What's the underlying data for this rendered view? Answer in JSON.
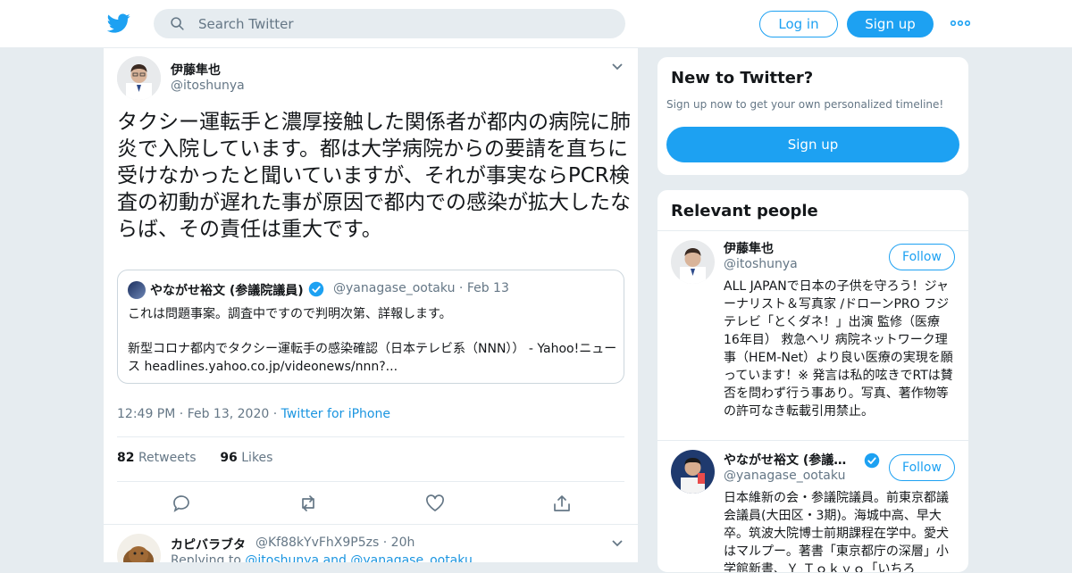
{
  "header": {
    "search_placeholder": "Search Twitter",
    "login_label": "Log in",
    "signup_label": "Sign up"
  },
  "tweet": {
    "author_name": "伊藤隼也",
    "author_handle": "@itoshunya",
    "text": "タクシー運転手と濃厚接触した関係者が都内の病院に肺炎で入院しています。都は大学病院からの要請を直ちに受けなかったと聞いていますが、それが事実ならPCR検査の初動が遅れた事が原因で都内での感染が拡大したならば、その責任は重大です。",
    "quoted": {
      "name": "やながせ裕文 (参議院議員)",
      "handle": "@yanagase_ootaku",
      "date": "Feb 13",
      "line1": "これは問題事案。調査中ですので判明次第、詳報します。",
      "line2": "新型コロナ都内でタクシー運転手の感染確認（日本テレビ系（NNN）） - Yahoo!ニュース headlines.yahoo.co.jp/videonews/nnn?..."
    },
    "time": "12:49 PM",
    "date": "Feb 13, 2020",
    "source": "Twitter for iPhone",
    "retweets_count": "82",
    "retweets_label": "Retweets",
    "likes_count": "96",
    "likes_label": "Likes"
  },
  "reply": {
    "name": "カピバラブタ",
    "handle": "@Kf88kYvFhX9P5zs",
    "age": "20h",
    "replying_prefix": "Replying to",
    "replying_user1": "@itoshunya",
    "replying_and": "and",
    "replying_user2": "@yanagase_ootaku"
  },
  "new_to_twitter": {
    "title": "New to Twitter?",
    "subtitle": "Sign up now to get your own personalized timeline!",
    "button_label": "Sign up"
  },
  "relevant_people": {
    "title": "Relevant people",
    "people": [
      {
        "name": "伊藤隼也",
        "handle": "@itoshunya",
        "follow_label": "Follow",
        "bio": "ALL JAPANで日本の子供を守ろう！ジャーナリスト＆写真家 /ドローンPRO フジテレビ「とくダネ！」出演 監修（医療 16年目） 救急ヘリ 病院ネットワーク理事（HEM-Net）より良い医療の実現を願っています！※ 発言は私的呟きでRTは賛否を問わず行う事あり。写真、著作物等の許可なき転載引用禁止。"
      },
      {
        "name": "やながせ裕文 (参議…",
        "handle": "@yanagase_ootaku",
        "follow_label": "Follow",
        "bio": "日本維新の会・参議院議員。前東京都議会議員(大田区・3期)。海城中高、早大卒。筑波大院博士前期課程在学中。愛犬はマルプー。著書「東京都庁の深層」小学館新書、Ｙ Ｔｏｋｙｏ「いちろ"
      }
    ]
  },
  "colors": {
    "accent": "#1da1f2",
    "link": "#1b95e0",
    "muted": "#657786",
    "background": "#e6ecf0"
  }
}
